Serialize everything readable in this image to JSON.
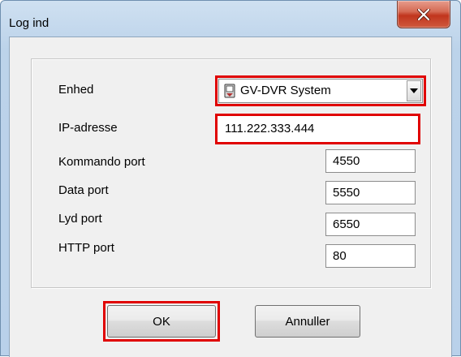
{
  "window": {
    "title": "Log ind",
    "close_icon": "close-x-icon",
    "accent_red": "#e00000"
  },
  "form": {
    "device": {
      "label": "Enhed",
      "value": "GV-DVR System",
      "icon": "dvr-device-icon"
    },
    "ip": {
      "label": "IP-adresse",
      "value": "111.222.333.444"
    },
    "command_port": {
      "label": "Kommando port",
      "value": "4550"
    },
    "data_port": {
      "label": "Data port",
      "value": "5550"
    },
    "audio_port": {
      "label": "Lyd port",
      "value": "6550"
    },
    "http_port": {
      "label": "HTTP port",
      "value": "80"
    }
  },
  "buttons": {
    "ok": "OK",
    "cancel": "Annuller"
  }
}
